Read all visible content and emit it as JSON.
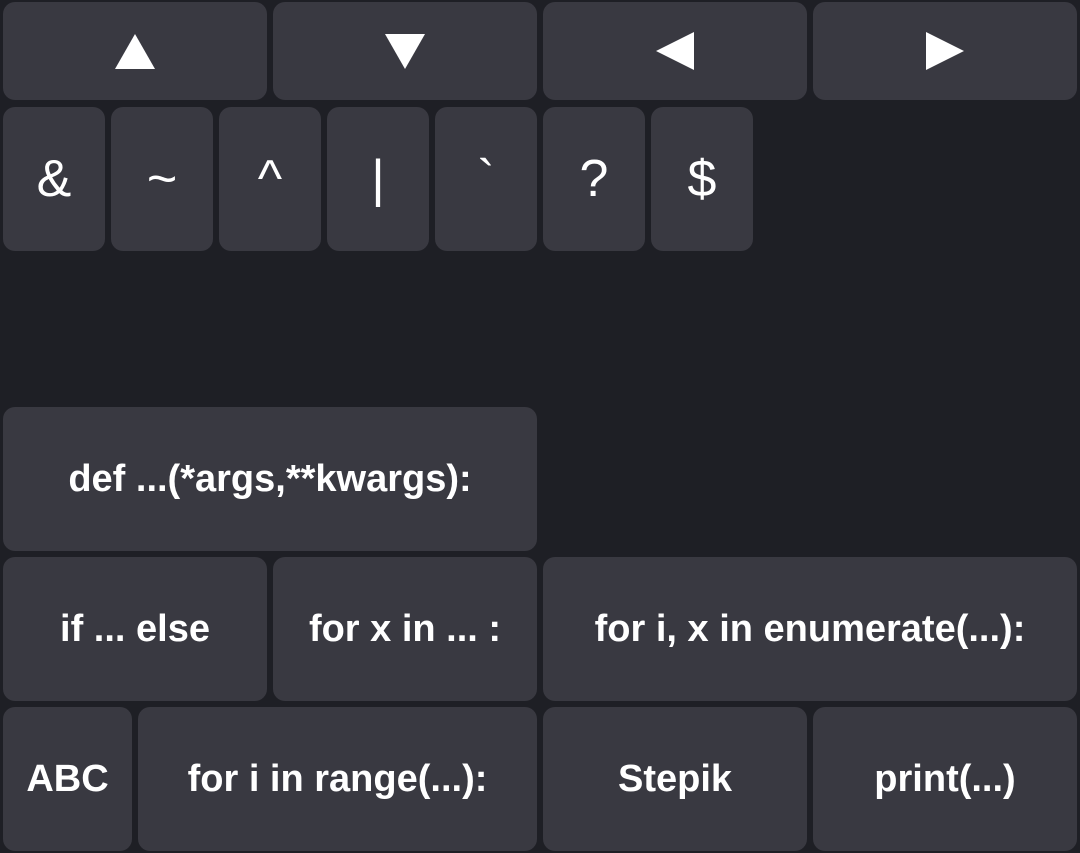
{
  "arrows": [
    {
      "name": "up-arrow-icon",
      "direction": "up"
    },
    {
      "name": "down-arrow-icon",
      "direction": "down"
    },
    {
      "name": "left-arrow-icon",
      "direction": "left"
    },
    {
      "name": "right-arrow-icon",
      "direction": "right"
    }
  ],
  "symbols": [
    "&",
    "~",
    "^",
    "|",
    "`",
    "?",
    "$"
  ],
  "snippets": {
    "def": "def ...(*args,**kwargs):",
    "if_else": "if ... else",
    "for_x": "for x in ... :",
    "for_enumerate": "for i, x in enumerate(...):",
    "abc": "ABC",
    "for_range": "for i in range(...):",
    "stepik": "Stepik",
    "print": "print(...)"
  },
  "colors": {
    "background": "#1e1f25",
    "key": "#393941",
    "text": "#ffffff"
  }
}
